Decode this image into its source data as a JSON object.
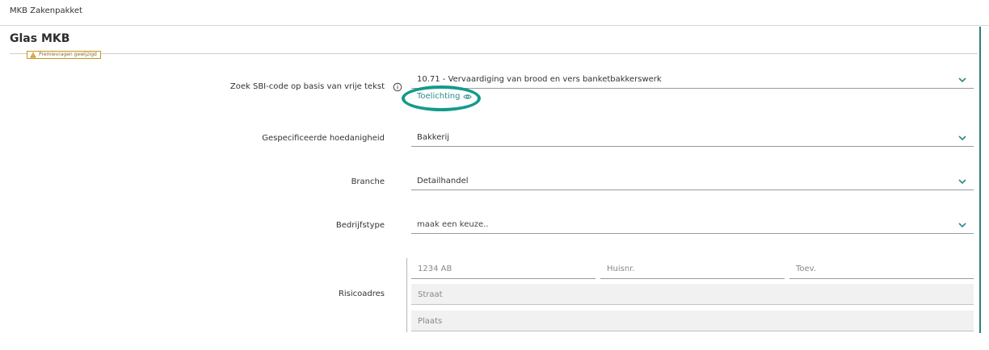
{
  "app": {
    "title": "MKB Zakenpakket"
  },
  "section": {
    "title": "Glas MKB",
    "warning": "Premievragen gewijzigd"
  },
  "form": {
    "sbi": {
      "label": "Zoek SBI-code op basis van vrije tekst",
      "info_icon": "info-circle-icon",
      "value": "10.71 - Vervaardiging van brood en vers banketbakkerswerk",
      "link": "Toelichting",
      "link_icon": "eye-icon"
    },
    "hoedanigheid": {
      "label": "Gespecificeerde hoedanigheid",
      "value": "Bakkerij"
    },
    "branche": {
      "label": "Branche",
      "value": "Detailhandel"
    },
    "bedrijfstype": {
      "label": "Bedrijfstype",
      "value": "maak een keuze.."
    },
    "risicoadres": {
      "label": "Risicoadres",
      "postcode_placeholder": "1234 AB",
      "huisnr_placeholder": "Huisnr.",
      "toev_placeholder": "Toev.",
      "straat_placeholder": "Straat",
      "plaats_placeholder": "Plaats"
    }
  },
  "colors": {
    "accent": "#2a8a89",
    "highlight": "#139a8d",
    "warning": "#c8961d"
  }
}
